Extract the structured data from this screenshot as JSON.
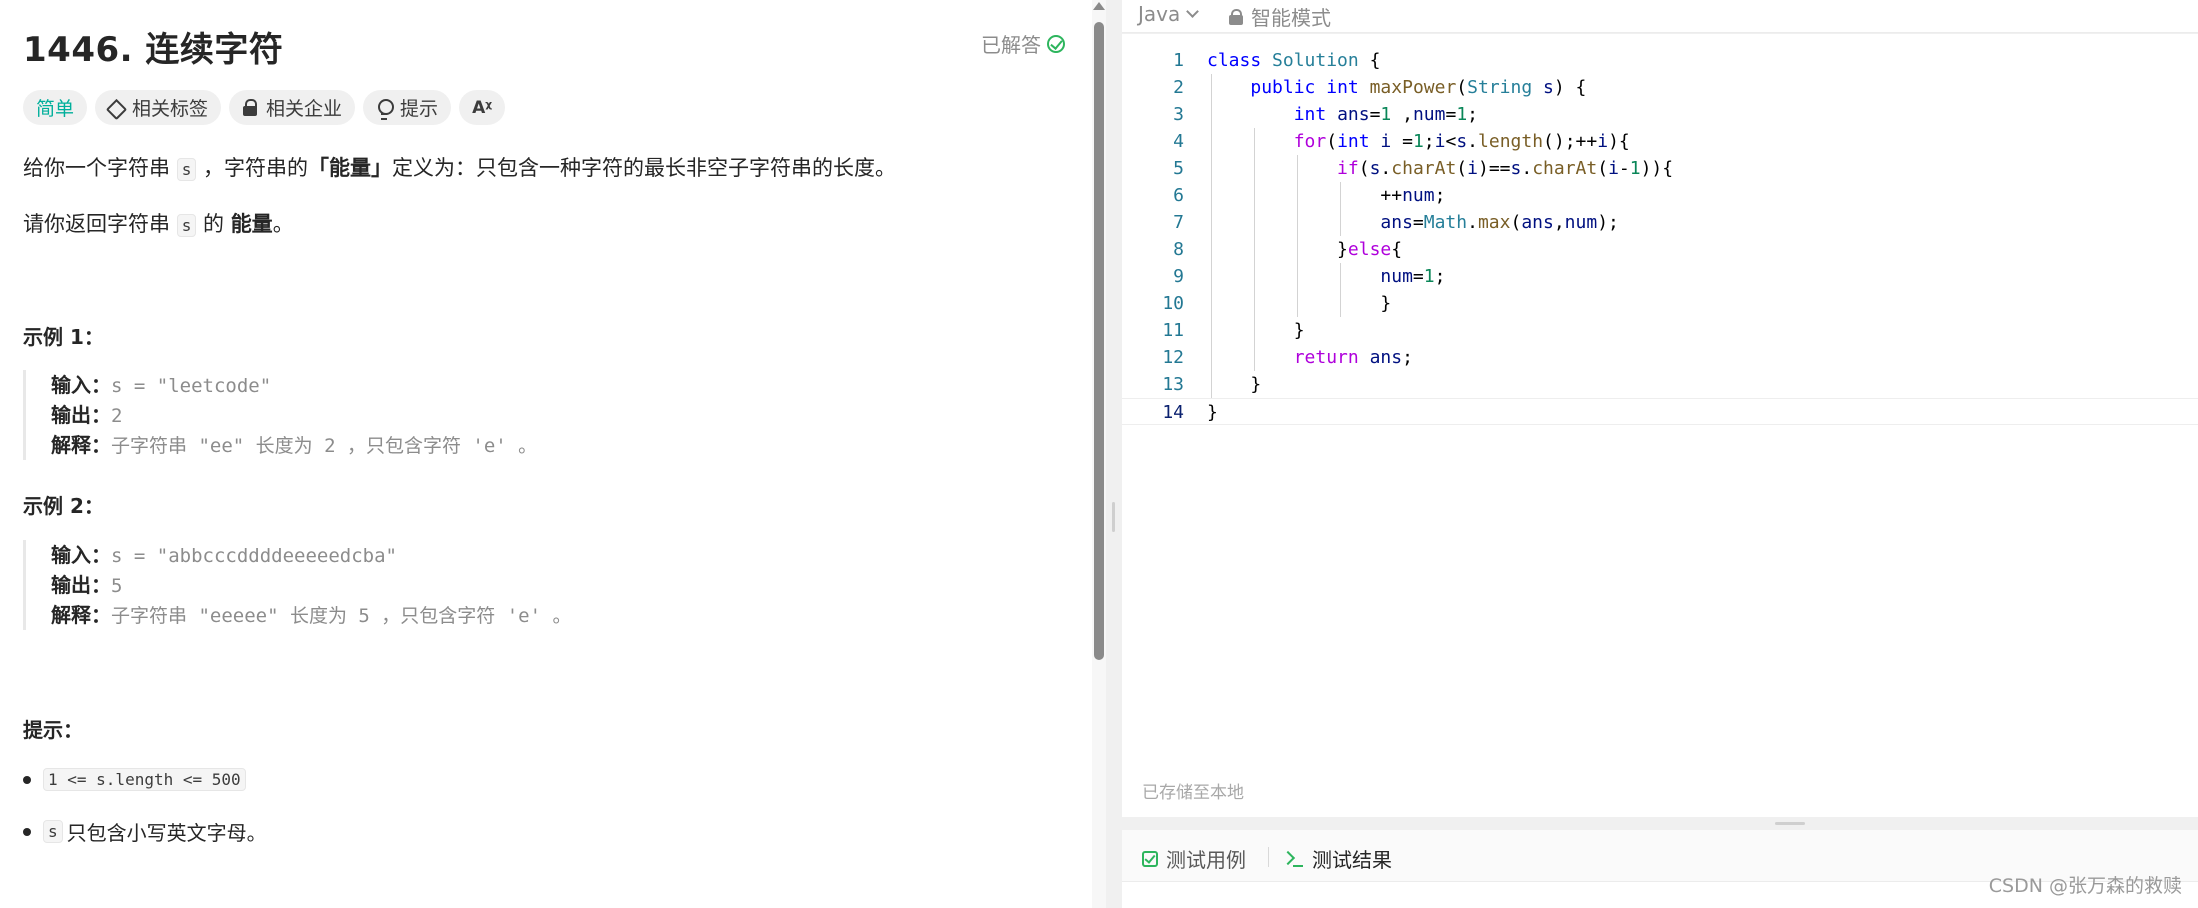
{
  "problem": {
    "title": "1446. 连续字符",
    "status": "已解答",
    "tags": {
      "difficulty": "简单",
      "related_tags": "相关标签",
      "related_companies": "相关企业",
      "hint": "提示",
      "translate": "Aᵡ"
    },
    "description": {
      "p1_before": "给你一个字符串 ",
      "p1_code": "s",
      "p1_mid": " ，字符串的",
      "p1_bold": "「能量」",
      "p1_after": "定义为：只包含一种字符的最长非空子字符串的长度。",
      "p2_before": "请你返回字符串 ",
      "p2_code": "s",
      "p2_mid": " 的 ",
      "p2_bold": "能量",
      "p2_after": "。"
    },
    "examples": [
      {
        "title": "示例 1：",
        "input_label": "输入：",
        "input": "s = \"leetcode\"",
        "output_label": "输出：",
        "output": "2",
        "explain_label": "解释：",
        "explain": "子字符串 \"ee\" 长度为 2 ，只包含字符 'e' 。"
      },
      {
        "title": "示例 2：",
        "input_label": "输入：",
        "input": "s = \"abbcccddddeeeeedcba\"",
        "output_label": "输出：",
        "output": "5",
        "explain_label": "解释：",
        "explain": "子字符串 \"eeeee\" 长度为 5 ，只包含字符 'e' 。"
      }
    ],
    "hints": {
      "title": "提示：",
      "item1_code": "1 <= s.length <= 500",
      "item2_code": "s",
      "item2_text": "只包含小写英文字母。"
    }
  },
  "editor": {
    "language": "Java",
    "mode": "智能模式",
    "saved_status": "已存储至本地",
    "line_numbers": [
      "1",
      "2",
      "3",
      "4",
      "5",
      "6",
      "7",
      "8",
      "9",
      "10",
      "11",
      "12",
      "13",
      "14"
    ],
    "code_lines": [
      "class Solution {",
      "    public int maxPower(String s) {",
      "        int ans=1 ,num=1;",
      "        for(int i =1;i<s.length();++i){",
      "            if(s.charAt(i)==s.charAt(i-1)){",
      "                ++num;",
      "                ans=Math.max(ans,num);",
      "            }else{",
      "                num=1;",
      "                }",
      "        }",
      "        return ans;",
      "    }",
      "}"
    ]
  },
  "console": {
    "tab_testcase": "测试用例",
    "tab_result": "测试结果"
  },
  "watermark": "CSDN @张万森的救赎"
}
